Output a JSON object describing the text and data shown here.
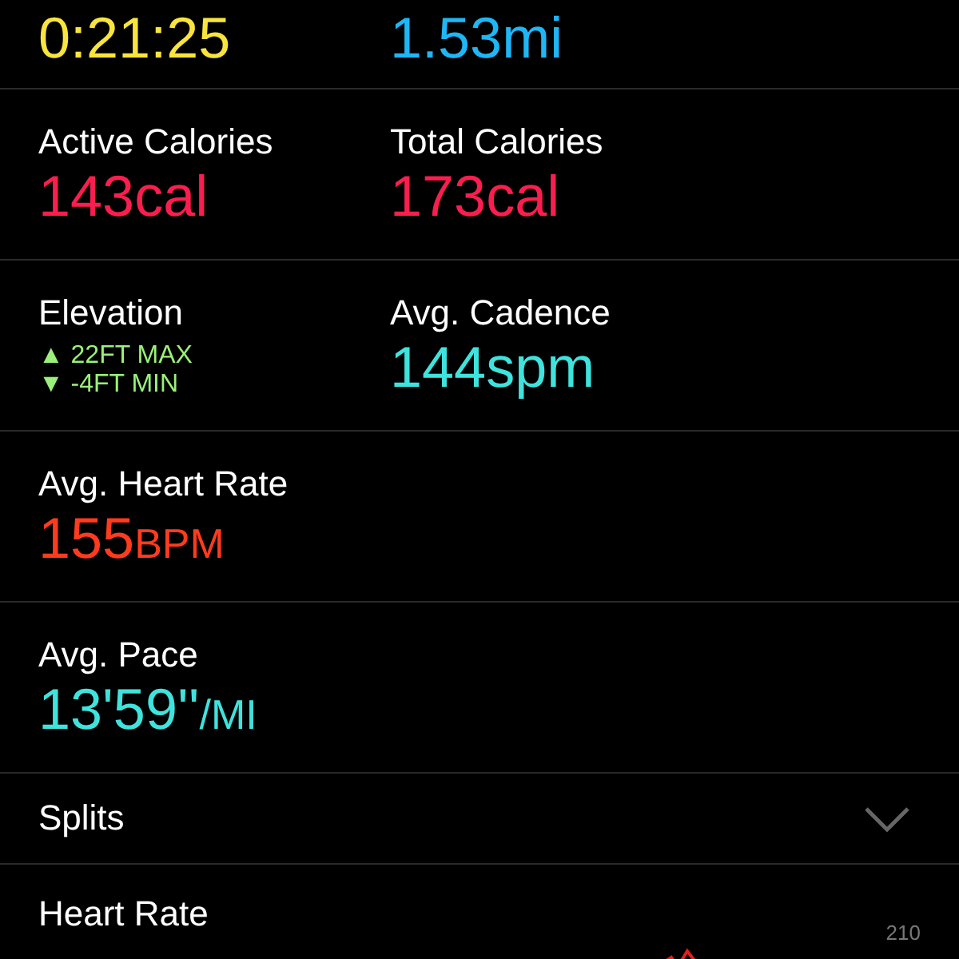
{
  "rows": [
    {
      "cells": [
        {
          "kind": "value",
          "value": "0:21:25",
          "color": "#f8e43c"
        },
        {
          "kind": "value",
          "value": "1.53",
          "unit": "mi",
          "color": "#1fb6f5"
        }
      ]
    },
    {
      "cells": [
        {
          "kind": "value",
          "label": "Active Calories",
          "value": "143",
          "unit": "cal",
          "color": "#fa1e4e"
        },
        {
          "kind": "value",
          "label": "Total Calories",
          "value": "173",
          "unit": "cal",
          "color": "#fa1e4e"
        }
      ]
    },
    {
      "cells": [
        {
          "kind": "elevation",
          "label": "Elevation",
          "max": "▲ 22FT MAX",
          "min": "▼ -4FT MIN",
          "color": "#9af07a"
        },
        {
          "kind": "value",
          "label": "Avg. Cadence",
          "value": "144",
          "unit": "spm",
          "color": "#3fe3dd"
        }
      ]
    },
    {
      "cells": [
        {
          "kind": "value",
          "label": "Avg. Heart Rate",
          "value": "155",
          "unit": "BPM",
          "small_unit": true,
          "color": "#ff3b1e"
        }
      ]
    },
    {
      "cells": [
        {
          "kind": "value",
          "label": "Avg. Pace",
          "value": "13'59''",
          "unit": "/MI",
          "small_unit": true,
          "color": "#3fe3dd"
        }
      ]
    }
  ],
  "splits": {
    "label": "Splits",
    "expanded": false
  },
  "heart_rate": {
    "label": "Heart Rate",
    "tick": "210"
  }
}
